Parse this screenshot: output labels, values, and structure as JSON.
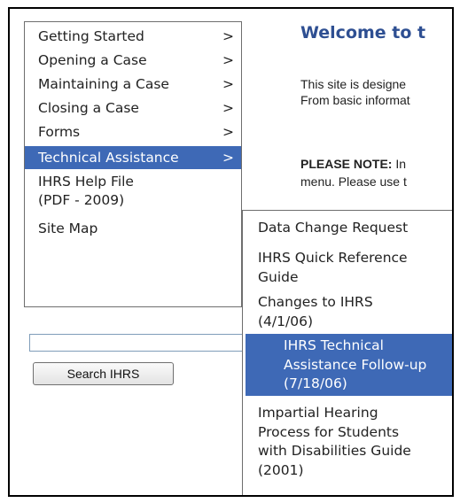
{
  "nav": {
    "items": [
      {
        "label": "Getting Started",
        "arrow": ">"
      },
      {
        "label": "Opening a Case",
        "arrow": ">"
      },
      {
        "label": "Maintaining a Case",
        "arrow": ">"
      },
      {
        "label": "Closing a Case",
        "arrow": ">"
      },
      {
        "label": "Forms",
        "arrow": ">"
      },
      {
        "label": "Technical Assistance",
        "arrow": ">"
      },
      {
        "label": "IHRS Help File\n(PDF - 2009)"
      },
      {
        "label": "Site Map"
      }
    ]
  },
  "content": {
    "welcome": "Welcome to t",
    "para_line1": "This site is designe",
    "para_line2": "From basic informat",
    "note_label": "PLEASE NOTE:",
    "note_text": " In",
    "note_line2": "menu. Please use t"
  },
  "search": {
    "input_value": "",
    "button_label": "Search IHRS"
  },
  "submenu": {
    "items": [
      {
        "label": "Data Change Request"
      },
      {
        "label": "IHRS Quick Reference\nGuide"
      },
      {
        "label": "Changes to IHRS\n(4/1/06)"
      },
      {
        "label": "IHRS Technical\nAssistance Follow-up\n(7/18/06)"
      },
      {
        "label": "Impartial Hearing\nProcess for Students\nwith Disabilities Guide\n(2001)"
      }
    ]
  },
  "colors": {
    "highlight": "#3e69b6",
    "heading": "#2e4f92"
  }
}
